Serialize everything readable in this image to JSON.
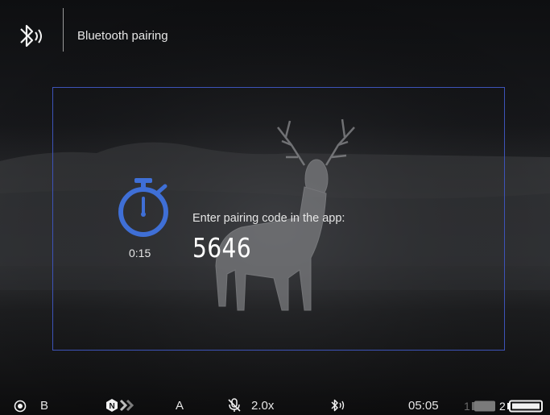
{
  "header": {
    "title": "Bluetooth pairing",
    "icon": "bluetooth-signal-icon"
  },
  "dialog": {
    "timer": "0:15",
    "timer_icon": "stopwatch-icon",
    "prompt": "Enter pairing code in the app:",
    "code": "5646"
  },
  "statusbar": {
    "mode": "B",
    "mode_icon": "record-icon",
    "nav_icon": "navigation-n-icon",
    "calibration": "A",
    "mic_icon": "mic-muted-icon",
    "zoom": "2.0x",
    "bt_icon": "bluetooth-signal-icon",
    "time": "05:05",
    "battery1_label": "1",
    "battery2_label": "2",
    "battery1_icon": "battery-icon",
    "battery2_icon": "battery-icon"
  },
  "colors": {
    "accent": "#3f6fd6",
    "frame": "#3d53b8",
    "background": "#0d0e10"
  }
}
